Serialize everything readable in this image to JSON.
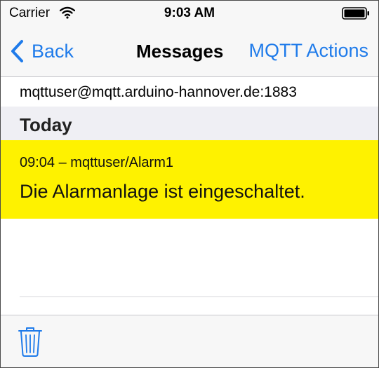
{
  "status_bar": {
    "carrier": "Carrier",
    "time": "9:03 AM",
    "wifi_icon": "wifi-icon",
    "battery_icon": "battery-icon"
  },
  "nav": {
    "back_label": "Back",
    "back_icon": "chevron-left-icon",
    "title": "Messages",
    "action_label": "MQTT Actions"
  },
  "server": {
    "address": "mqttuser@mqtt.arduino-hannover.de:1883"
  },
  "sections": [
    {
      "title": "Today",
      "messages": [
        {
          "meta": "09:04 – mqttuser/Alarm1",
          "text": "Die Alarmanlage ist eingeschaltet.",
          "highlight_color": "#fef200"
        }
      ]
    }
  ],
  "toolbar": {
    "trash_icon": "trash-icon"
  },
  "colors": {
    "accent": "#1f7bea",
    "highlight": "#fef200",
    "section_bg": "#efeff4"
  }
}
